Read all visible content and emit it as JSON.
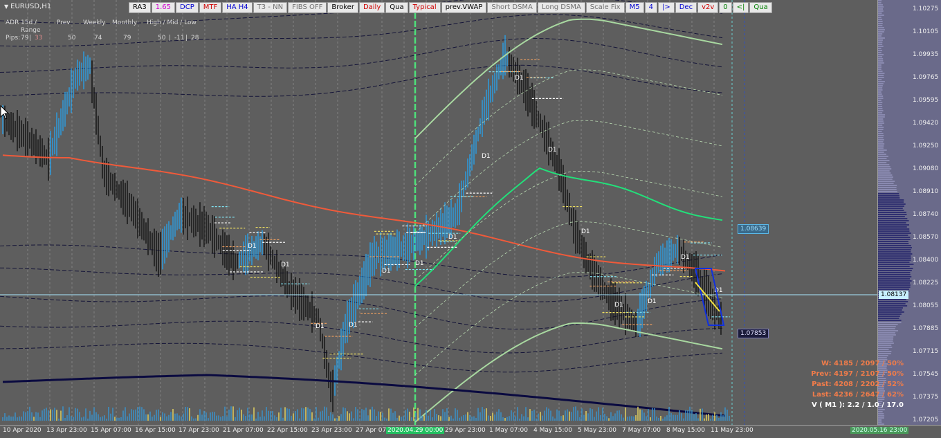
{
  "symbol": "EURUSD,H1",
  "toolbar": [
    {
      "label": "RA3",
      "color": "#000000",
      "bg": "#e8e8e8"
    },
    {
      "label": "1.65",
      "color": "#d000d0",
      "bg": "#e8e8e8"
    },
    {
      "label": "DCP",
      "color": "#0000d0",
      "bg": "#e8e8e8"
    },
    {
      "label": "MTF",
      "color": "#d00000",
      "bg": "#e8e8e8"
    },
    {
      "label": "HA H4",
      "color": "#0000d0",
      "bg": "#e8e8e8"
    },
    {
      "label": "T3 - NN",
      "color": "#707070",
      "bg": "#e8e8e8"
    },
    {
      "label": "FIBS OFF",
      "color": "#707070",
      "bg": "#e8e8e8"
    },
    {
      "label": "Broker",
      "color": "#000000",
      "bg": "#e8e8e8"
    },
    {
      "label": "Daily",
      "color": "#d00000",
      "bg": "#e8e8e8"
    },
    {
      "label": "Qua",
      "color": "#000000",
      "bg": "#e8e8e8"
    },
    {
      "label": "Typical",
      "color": "#d00000",
      "bg": "#e8e8e8"
    },
    {
      "label": "prev.VWAP",
      "color": "#000000",
      "bg": "#e8e8e8"
    },
    {
      "label": "Short DSMA",
      "color": "#707070",
      "bg": "#e8e8e8"
    },
    {
      "label": "Long DSMA",
      "color": "#707070",
      "bg": "#e8e8e8"
    },
    {
      "label": "Scale Fix",
      "color": "#707070",
      "bg": "#e8e8e8"
    },
    {
      "label": "M5",
      "color": "#0000d0",
      "bg": "#e8e8e8"
    },
    {
      "label": "4",
      "color": "#0000d0",
      "bg": "#e8e8e8"
    },
    {
      "label": "|>",
      "color": "#0000d0",
      "bg": "#e8e8e8"
    },
    {
      "label": "Dec",
      "color": "#0000d0",
      "bg": "#e8e8e8"
    },
    {
      "label": "v2v",
      "color": "#d00000",
      "bg": "#e8e8e8"
    },
    {
      "label": "0",
      "color": "#008000",
      "bg": "#e8e8e8"
    },
    {
      "label": "<|",
      "color": "#008000",
      "bg": "#e8e8e8"
    },
    {
      "label": "Qua",
      "color": "#008000",
      "bg": "#e8e8e8"
    }
  ],
  "adr": {
    "headers": [
      "ADR",
      "15d / Range",
      "Prev",
      "Weekly",
      "Monthly",
      "High / Mid / Low"
    ],
    "pips_label": "Pips:",
    "range_15d": "79",
    "range_sep": "|",
    "range_val": "33",
    "prev": "50",
    "weekly": "74",
    "monthly": "79",
    "high": "50",
    "mid": "-11",
    "low": "28",
    "range_val_color": "#d88a8a"
  },
  "price_ticks": [
    "1.10275",
    "1.10105",
    "1.09935",
    "1.09765",
    "1.09595",
    "1.09420",
    "1.09250",
    "1.09080",
    "1.08910",
    "1.08740",
    "1.08570",
    "1.08400",
    "1.08225",
    "1.08055",
    "1.07885",
    "1.07715",
    "1.07545",
    "1.07375",
    "1.07205"
  ],
  "current_price": "1.08137",
  "price_box_high": "1.08639",
  "price_box_low": "1.07853",
  "time_labels": [
    "10 Apr 2020",
    "13 Apr 23:00",
    "15 Apr 07:00",
    "16 Apr 15:00",
    "17 Apr 23:00",
    "21 Apr 07:00",
    "22 Apr 15:00",
    "23 Apr 23:00",
    "27 Apr 07:00",
    "2020.04.29 00:00",
    "29 Apr 23:00",
    "1 May 07:00",
    "4 May 15:00",
    "5 May 23:00",
    "7 May 07:00",
    "8 May 15:00",
    "11 May 23:00",
    "2020.05.16 23:00"
  ],
  "d1_label": "D1",
  "stats": {
    "w": "W: 4185 / 2097 / 50%",
    "prev": "Prev: 4197 / 2107 / 50%",
    "past": "Past: 4208 / 2202 / 52%",
    "last": "Last: 4236 / 2647 / 62%",
    "volume": "V ( M1 ): 2.2 / 1.0 / 17.0"
  },
  "colors": {
    "background": "#5e5e5e",
    "ma_red": "#f05a3a",
    "ma_green": "#22e07a",
    "band_green": "#a8d8a0",
    "navy": "#0a0a40",
    "up_bar": "#2aa0e8",
    "down_bar": "#111111",
    "price_line": "#a8e8ff"
  }
}
